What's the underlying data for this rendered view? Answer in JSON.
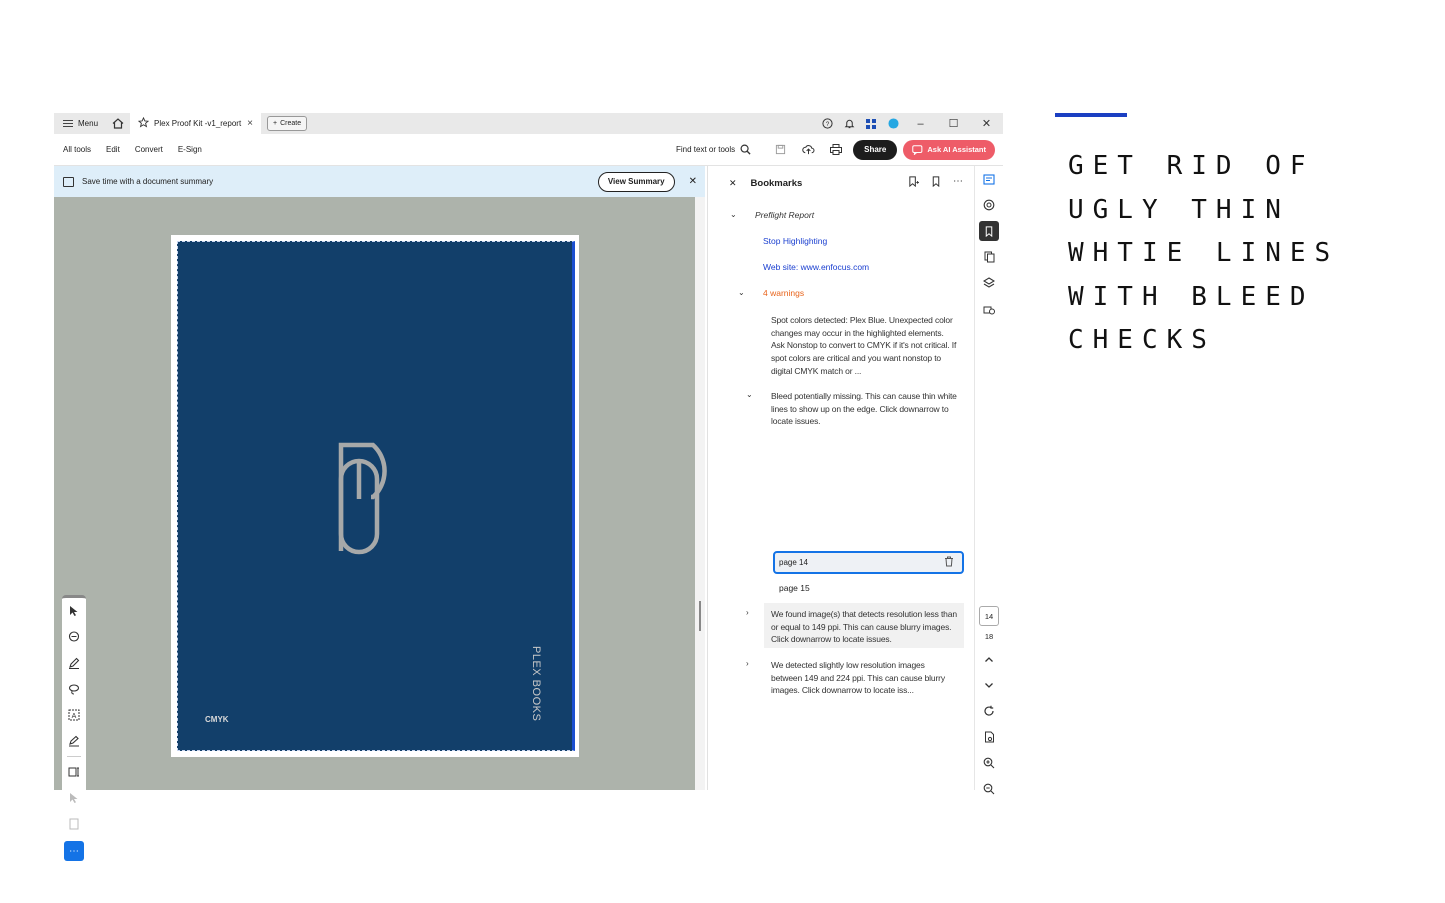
{
  "titlebar": {
    "menu_label": "Menu",
    "tab_title": "Plex Proof Kit -v1_report…",
    "create_label": "Create"
  },
  "toolbar": {
    "items": [
      "All tools",
      "Edit",
      "Convert",
      "E-Sign"
    ],
    "find_label": "Find text or tools",
    "share_label": "Share",
    "ai_label": "Ask AI Assistant"
  },
  "banner": {
    "text": "Save time with a document summary",
    "button_label": "View Summary"
  },
  "document": {
    "brand_vertical": "PLEX BOOKS",
    "cmyk_label": "CMYK",
    "cover_color": "#123f6a"
  },
  "bookmarks": {
    "title": "Bookmarks",
    "preflight": "Preflight Report",
    "stop_highlighting": "Stop Highlighting",
    "website": "Web site: www.enfocus.com",
    "warnings_label": "4 warnings",
    "warning_1": "Spot colors detected: Plex Blue. Unexpected color changes may occur in the highlighted elements. Ask Nonstop to convert to CMYK if it's not critical. If spot colors are critical and you want nonstop to digital CMYK match or ...",
    "warning_2": "Bleed potentially missing. This can cause thin white lines to show up on the edge. Click downarrow to locate issues.",
    "page_a": "page 14",
    "page_b": "page 15",
    "warning_3": "We found image(s) that detects resolution less than or equal to 149 ppi. This can cause blurry images. Click downarrow to locate issues.",
    "warning_4": "We detected slightly low resolution images between 149 and 224 ppi. This can cause blurry images.  Click downarrow to locate iss..."
  },
  "rail": {
    "current_page": "14",
    "total_pages": "18"
  },
  "headline": {
    "lines": [
      "GET RID OF",
      "UGLY THIN",
      "WHTIE LINES",
      "WITH BLEED",
      "CHECKS"
    ],
    "accent_color": "#1b3fc2"
  }
}
